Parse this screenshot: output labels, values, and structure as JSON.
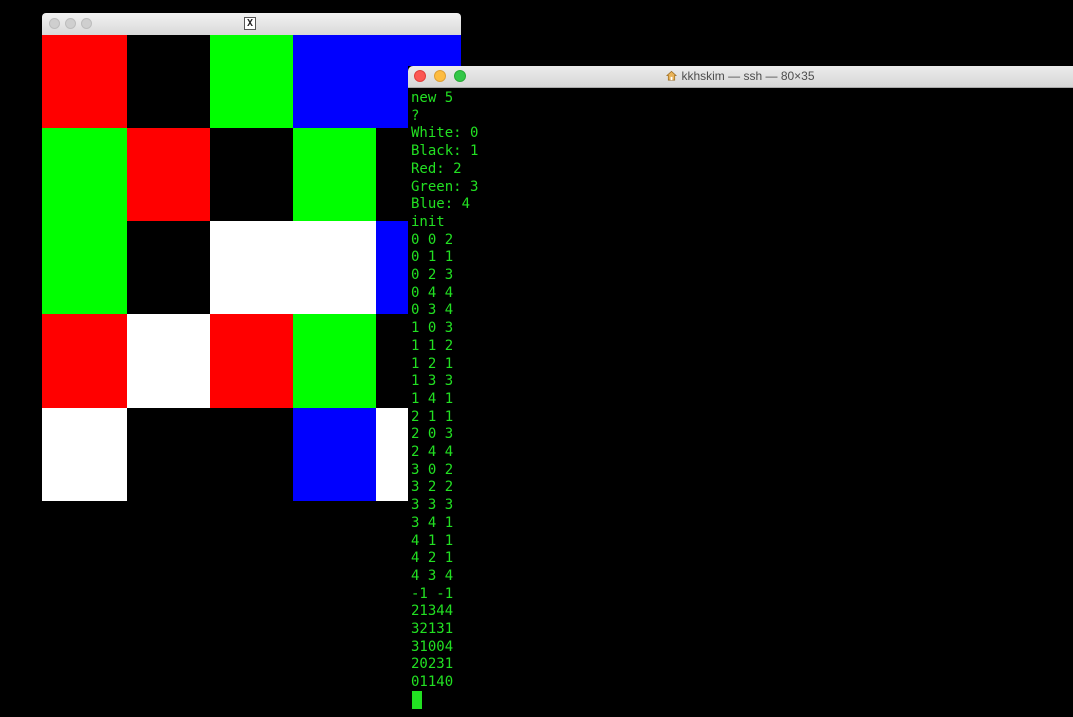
{
  "x_window": {
    "title_glyph": "X",
    "grid": [
      [
        "#ff0000",
        "#000000",
        "#00ff00",
        "#0000ff",
        "#0000ff"
      ],
      [
        "#00ff00",
        "#ff0000",
        "#000000",
        "#00ff00",
        "#000000"
      ],
      [
        "#00ff00",
        "#000000",
        "#ffffff",
        "#ffffff",
        "#0000ff"
      ],
      [
        "#ff0000",
        "#ffffff",
        "#ff0000",
        "#00ff00",
        "#000000"
      ],
      [
        "#ffffff",
        "#000000",
        "#000000",
        "#0000ff",
        "#ffffff"
      ]
    ]
  },
  "terminal": {
    "title": "kkhskim — ssh — 80×35",
    "text_color": "#22e022",
    "lines": [
      "new 5",
      "?",
      "White: 0",
      "Black: 1",
      "Red: 2",
      "Green: 3",
      "Blue: 4",
      "init",
      "0 0 2",
      "0 1 1",
      "0 2 3",
      "0 4 4",
      "0 3 4",
      "1 0 3",
      "1 1 2",
      "1 2 1",
      "1 3 3",
      "1 4 1",
      "2 1 1",
      "2 0 3",
      "2 4 4",
      "3 0 2",
      "3 2 2",
      "3 3 3",
      "3 4 1",
      "4 1 1",
      "4 2 1",
      "4 3 4",
      "-1 -1",
      "21344",
      "32131",
      "31004",
      "20231",
      "01140"
    ]
  }
}
